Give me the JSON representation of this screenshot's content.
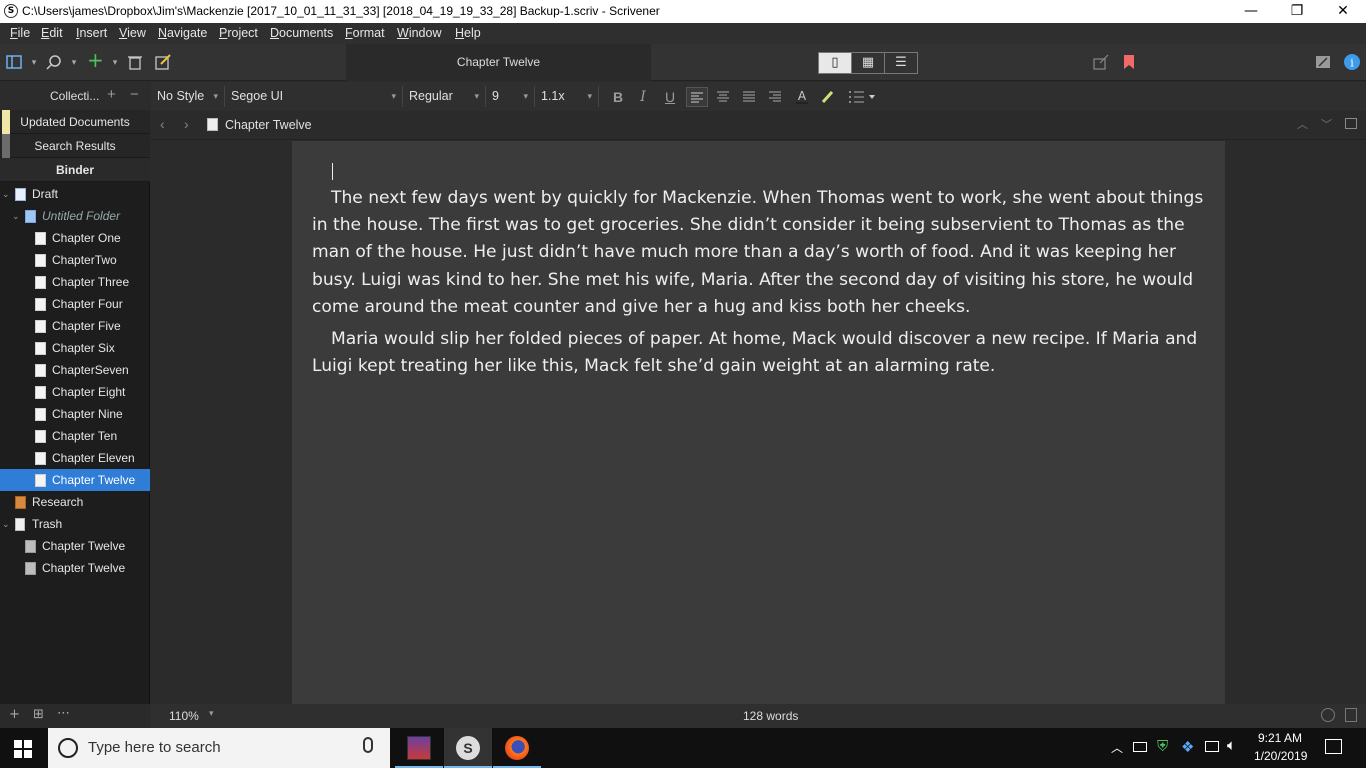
{
  "window": {
    "app_icon": "S",
    "title": "C:\\Users\\james\\Dropbox\\Jim's\\Mackenzie [2017_10_01_11_31_33] [2018_04_19_19_33_28] Backup-1.scriv - Scrivener",
    "controls": {
      "minimize": "—",
      "restore": "❐",
      "close": "✕"
    }
  },
  "menu": [
    "File",
    "Edit",
    "Insert",
    "View",
    "Navigate",
    "Project",
    "Documents",
    "Format",
    "Window",
    "Help"
  ],
  "toolbar": {
    "document_title": "Chapter Twelve",
    "icons": [
      "binder-toggle-icon",
      "search-icon",
      "add-icon",
      "trash-icon",
      "edit-icon",
      "single-view-icon",
      "grid-view-icon",
      "outline-view-icon",
      "share-icon",
      "bookmark-icon",
      "compose-icon",
      "info-icon"
    ]
  },
  "sidebar": {
    "collections_label": "Collecti...",
    "collections": [
      {
        "label": "Updated Documents",
        "color": "#f0e6a8"
      },
      {
        "label": "Search Results",
        "color": "#6c6c6c"
      },
      {
        "label": "Binder",
        "color": ""
      }
    ],
    "binder": [
      {
        "label": "Draft",
        "type": "draft",
        "level": 0,
        "expanded": true
      },
      {
        "label": "Untitled Folder",
        "type": "folder",
        "level": 1,
        "expanded": true
      },
      {
        "label": "Chapter One",
        "type": "doc",
        "level": 2
      },
      {
        "label": "ChapterTwo",
        "type": "doc",
        "level": 2
      },
      {
        "label": "Chapter Three",
        "type": "doc",
        "level": 2
      },
      {
        "label": "Chapter Four",
        "type": "doc",
        "level": 2
      },
      {
        "label": "Chapter Five",
        "type": "doc",
        "level": 2
      },
      {
        "label": "Chapter Six",
        "type": "doc",
        "level": 2
      },
      {
        "label": "ChapterSeven",
        "type": "doc",
        "level": 2
      },
      {
        "label": "Chapter Eight",
        "type": "doc",
        "level": 2
      },
      {
        "label": "Chapter Nine",
        "type": "doc",
        "level": 2
      },
      {
        "label": "Chapter Ten",
        "type": "doc",
        "level": 2
      },
      {
        "label": "Chapter Eleven",
        "type": "doc",
        "level": 2
      },
      {
        "label": "Chapter Twelve",
        "type": "doc",
        "level": 2,
        "selected": true
      },
      {
        "label": "Research",
        "type": "research",
        "level": 0
      },
      {
        "label": "Trash",
        "type": "trash",
        "level": 0,
        "expanded": true
      },
      {
        "label": "Chapter Twelve",
        "type": "trashdoc",
        "level": 1
      },
      {
        "label": "Chapter Twelve",
        "type": "trashdoc",
        "level": 1
      }
    ]
  },
  "format": {
    "style": "No Style",
    "font": "Segoe UI",
    "weight": "Regular",
    "size": "9",
    "line_spacing": "1.1x",
    "bold": "B",
    "italic": "I",
    "underline": "U"
  },
  "editor": {
    "header_title": "Chapter Twelve",
    "paragraphs": [
      "The next few days went by quickly for Mackenzie. When Thomas went to work, she went about things in the house. The first was to get groceries. She didn’t consider it being subservient to Thomas as the man of the house. He just didn’t have much more than a day’s worth of food. And it was keeping her busy. Luigi was kind to her. She met his wife, Maria. After the second day of visiting his store, he would come around the meat counter and give her a hug and kiss both her cheeks.",
      "Maria would slip her folded pieces of paper. At home, Mack would discover a new recipe. If Maria and Luigi kept treating her like this, Mack felt she’d gain weight at an alarming rate."
    ]
  },
  "status": {
    "zoom": "110%",
    "word_count": "128 words"
  },
  "taskbar": {
    "search_placeholder": "Type here to search",
    "time": "9:21 AM",
    "date": "1/20/2019"
  }
}
